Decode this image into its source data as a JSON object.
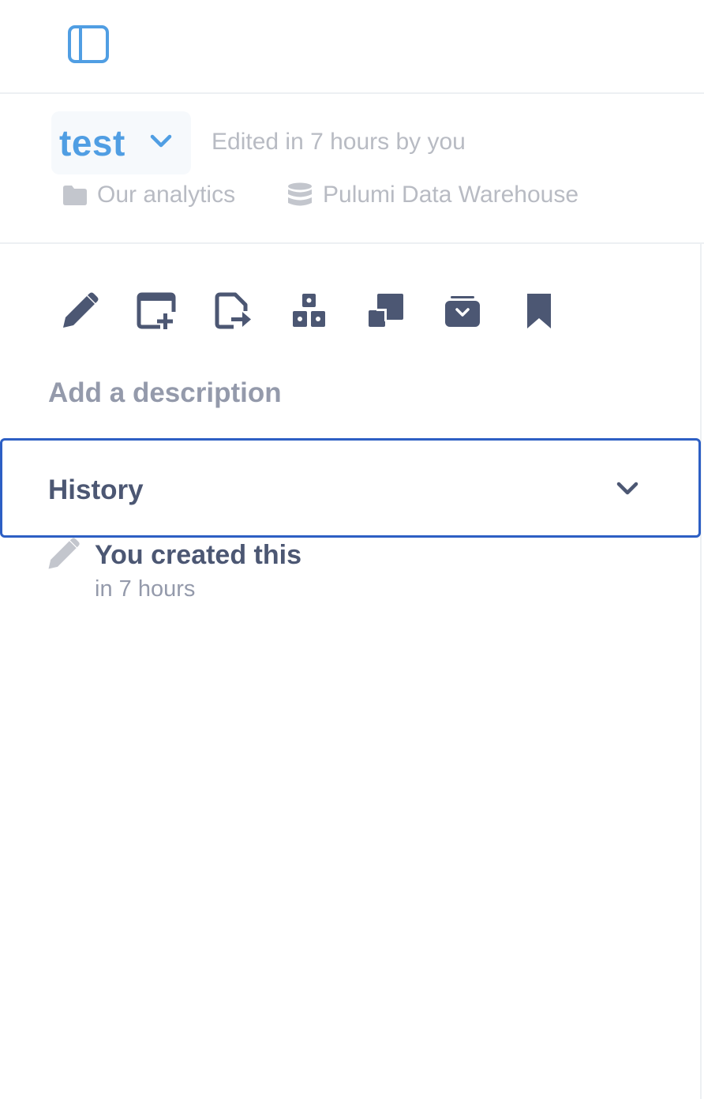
{
  "topbar": {
    "sidebar_toggle_icon": "sidebar-panel-icon"
  },
  "header": {
    "title": "test",
    "edited": "Edited in 7 hours by you",
    "collection": "Our analytics",
    "database": "Pulumi Data Warehouse"
  },
  "actions": [
    {
      "icon": "pencil-icon"
    },
    {
      "icon": "add-to-dashboard-icon"
    },
    {
      "icon": "move-icon"
    },
    {
      "icon": "add-to-model-icon"
    },
    {
      "icon": "duplicate-icon"
    },
    {
      "icon": "archive-icon"
    },
    {
      "icon": "bookmark-icon"
    }
  ],
  "description_placeholder": "Add a description",
  "history": {
    "label": "History",
    "events": [
      {
        "title": "You created this",
        "time": "in 7 hours"
      }
    ]
  },
  "colors": {
    "brand": "#509ee3",
    "text_dark": "#4c5773",
    "text_light": "#949aab",
    "focus_border": "#2d5fc4"
  }
}
